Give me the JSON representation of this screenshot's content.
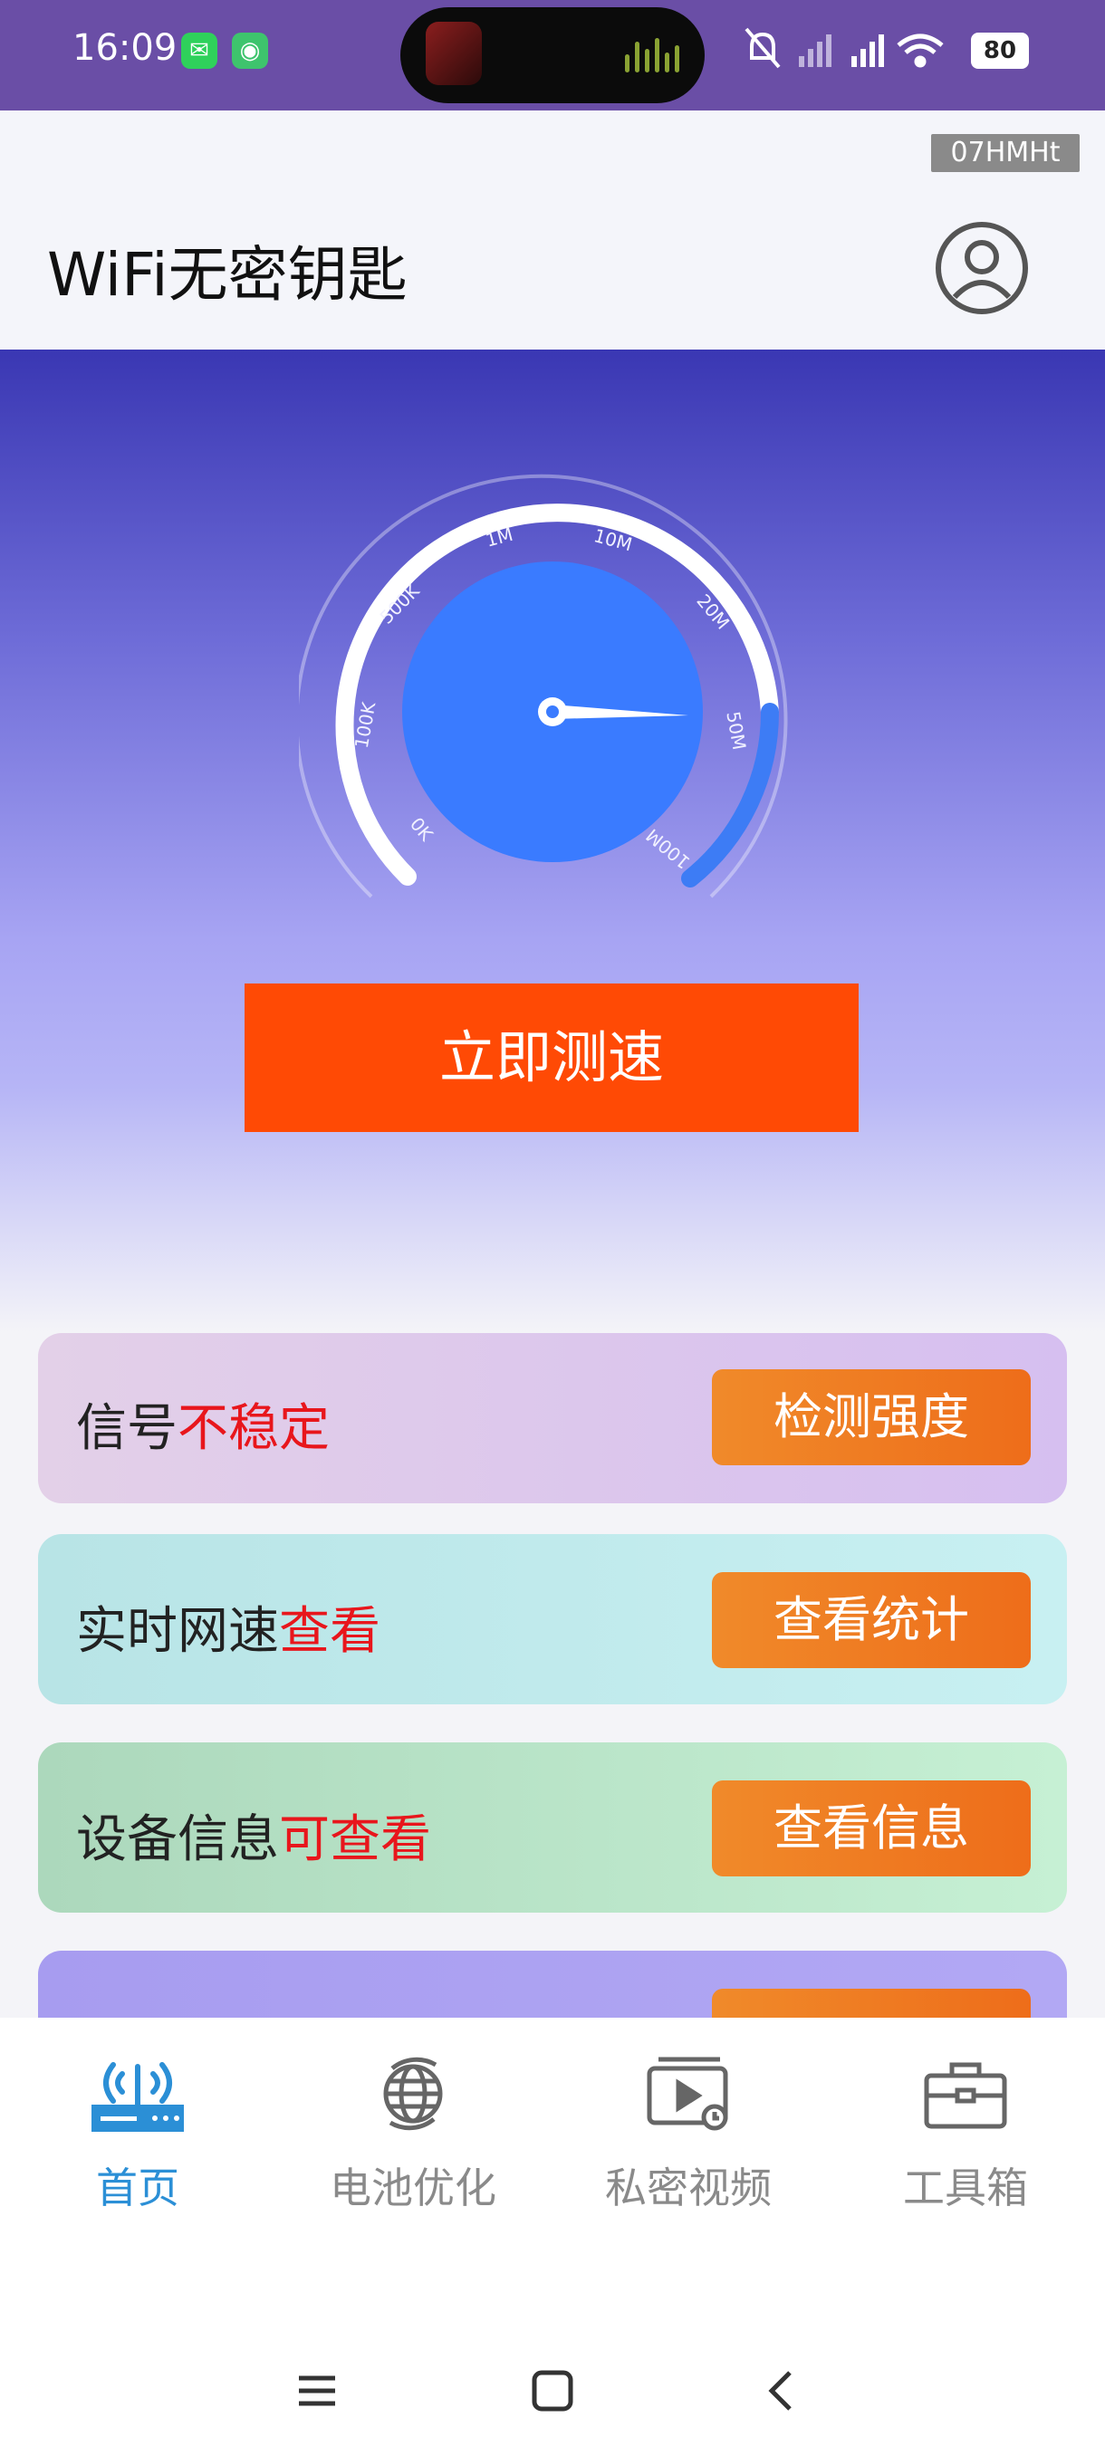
{
  "status_bar": {
    "time": "16:09",
    "battery": "80"
  },
  "header": {
    "badge": "07HMHt",
    "title": "WiFi无密钥匙"
  },
  "gauge": {
    "ticks": [
      "0K",
      "100K",
      "500K",
      "1M",
      "10M",
      "20M",
      "50M",
      "100M"
    ]
  },
  "hero": {
    "button": "立即测速"
  },
  "cards": [
    {
      "label": "信号",
      "highlight": "不稳定",
      "button": "检测强度",
      "bg": "#dcc4ec"
    },
    {
      "label": "实时网速",
      "highlight": "查看",
      "button": "查看统计",
      "bg": "#bfe8ec"
    },
    {
      "label": "设备信息",
      "highlight": "可查看",
      "button": "查看信息",
      "bg": "#bfe6cc"
    }
  ],
  "nav": [
    {
      "label": "首页",
      "icon": "router-icon",
      "active": true
    },
    {
      "label": "电池优化",
      "icon": "globe-icon",
      "active": false
    },
    {
      "label": "私密视频",
      "icon": "video-icon",
      "active": false
    },
    {
      "label": "工具箱",
      "icon": "toolbox-icon",
      "active": false
    }
  ],
  "colors": {
    "accent": "#ff4a05",
    "active_nav": "#2b8fd6",
    "highlight": "#e8161c"
  }
}
